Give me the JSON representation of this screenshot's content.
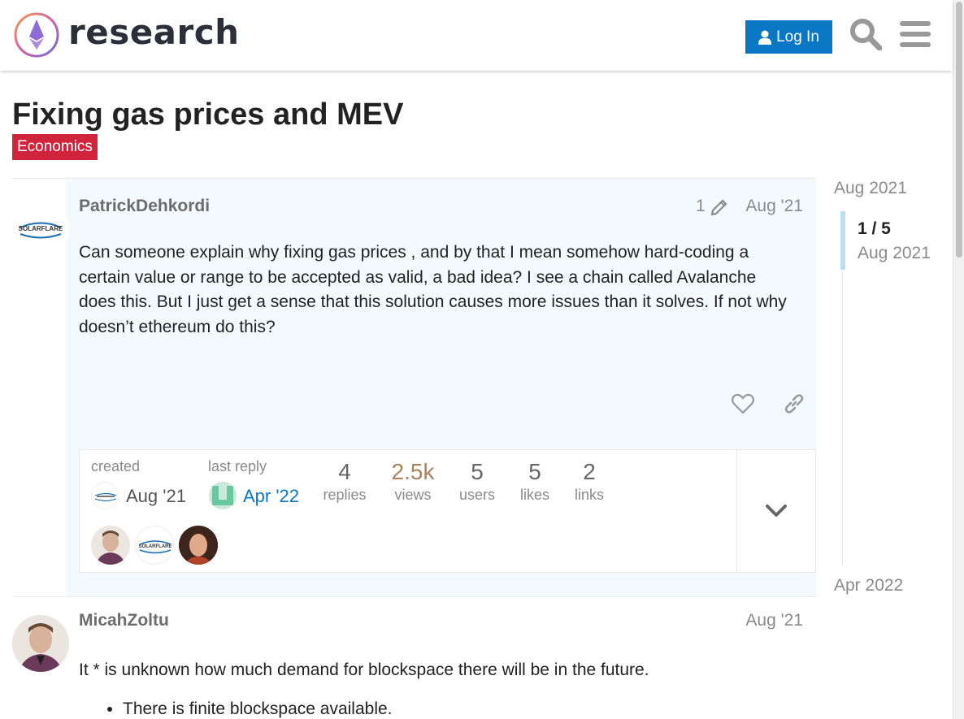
{
  "header": {
    "site_name": "research",
    "login_label": "Log In"
  },
  "topic": {
    "title": "Fixing gas prices and MEV",
    "category": "Economics",
    "category_color": "#d0243c"
  },
  "posts": [
    {
      "username": "PatrickDehkordi",
      "edit_count": "1",
      "date": "Aug '21",
      "text": "Can someone explain why fixing gas prices , and by that I mean somehow hard-coding a certain value or range to be accepted as valid, a bad idea? I see a chain called Avalanche does this. But I just get a sense that this solution causes more issues than it solves. If not why doesn’t ethereum do this?"
    },
    {
      "username": "MicahZoltu",
      "date": "Aug '21",
      "text": "It * is unknown how much demand for blockspace there will be in the future.",
      "bullets": [
        "There is finite blockspace available."
      ]
    }
  ],
  "topic_map": {
    "created_label": "created",
    "created_date": "Aug '21",
    "last_reply_label": "last reply",
    "last_reply_date": "Apr '22",
    "stats": [
      {
        "value": "4",
        "label": "replies"
      },
      {
        "value": "2.5k",
        "label": "views"
      },
      {
        "value": "5",
        "label": "users"
      },
      {
        "value": "5",
        "label": "likes"
      },
      {
        "value": "2",
        "label": "links"
      }
    ]
  },
  "timeline": {
    "start": "Aug 2021",
    "position": "1 / 5",
    "position_date": "Aug 2021",
    "end": "Apr 2022"
  },
  "icons": {
    "login": "user-icon",
    "search": "search-icon",
    "menu": "hamburger-menu-icon",
    "edit": "pencil-icon",
    "like": "heart-icon",
    "share": "link-icon",
    "expand": "chevron-down-icon"
  },
  "colors": {
    "primary": "#0a77c4",
    "views_highlight": "#a9845a",
    "post_highlight_bg": "#f3f9fd"
  }
}
